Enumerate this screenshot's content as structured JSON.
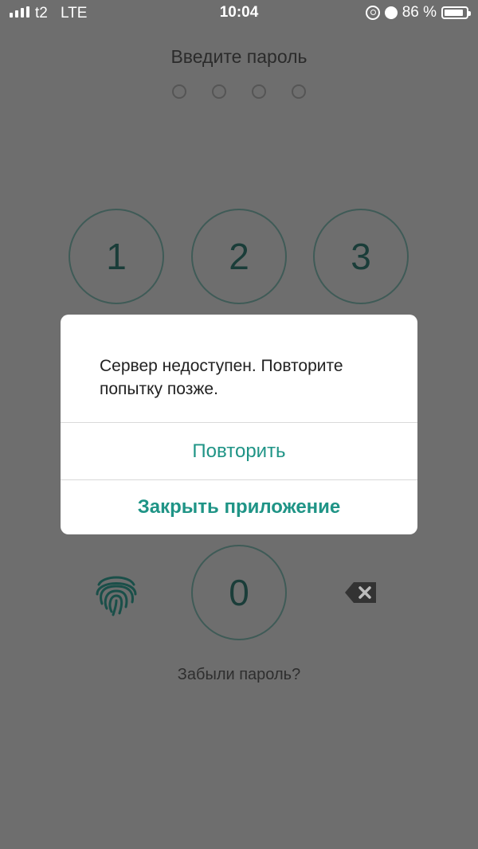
{
  "status_bar": {
    "carrier": "t2",
    "network": "LTE",
    "time": "10:04",
    "battery": "86 %"
  },
  "screen": {
    "title": "Введите пароль",
    "keys": {
      "k1": "1",
      "k2": "2",
      "k3": "3",
      "k0": "0"
    },
    "forgot_password": "Забыли пароль?"
  },
  "dialog": {
    "message": "Сервер недоступен. Повторите попытку позже.",
    "retry_label": "Повторить",
    "close_label": "Закрыть приложение"
  },
  "colors": {
    "overlay": "#6e6e6e",
    "accent": "#1f9486",
    "key_border": "#3f5b57"
  },
  "icons": [
    "signal-icon",
    "rotation-lock-icon",
    "alarm-icon",
    "battery-icon",
    "fingerprint-icon",
    "backspace-icon"
  ]
}
